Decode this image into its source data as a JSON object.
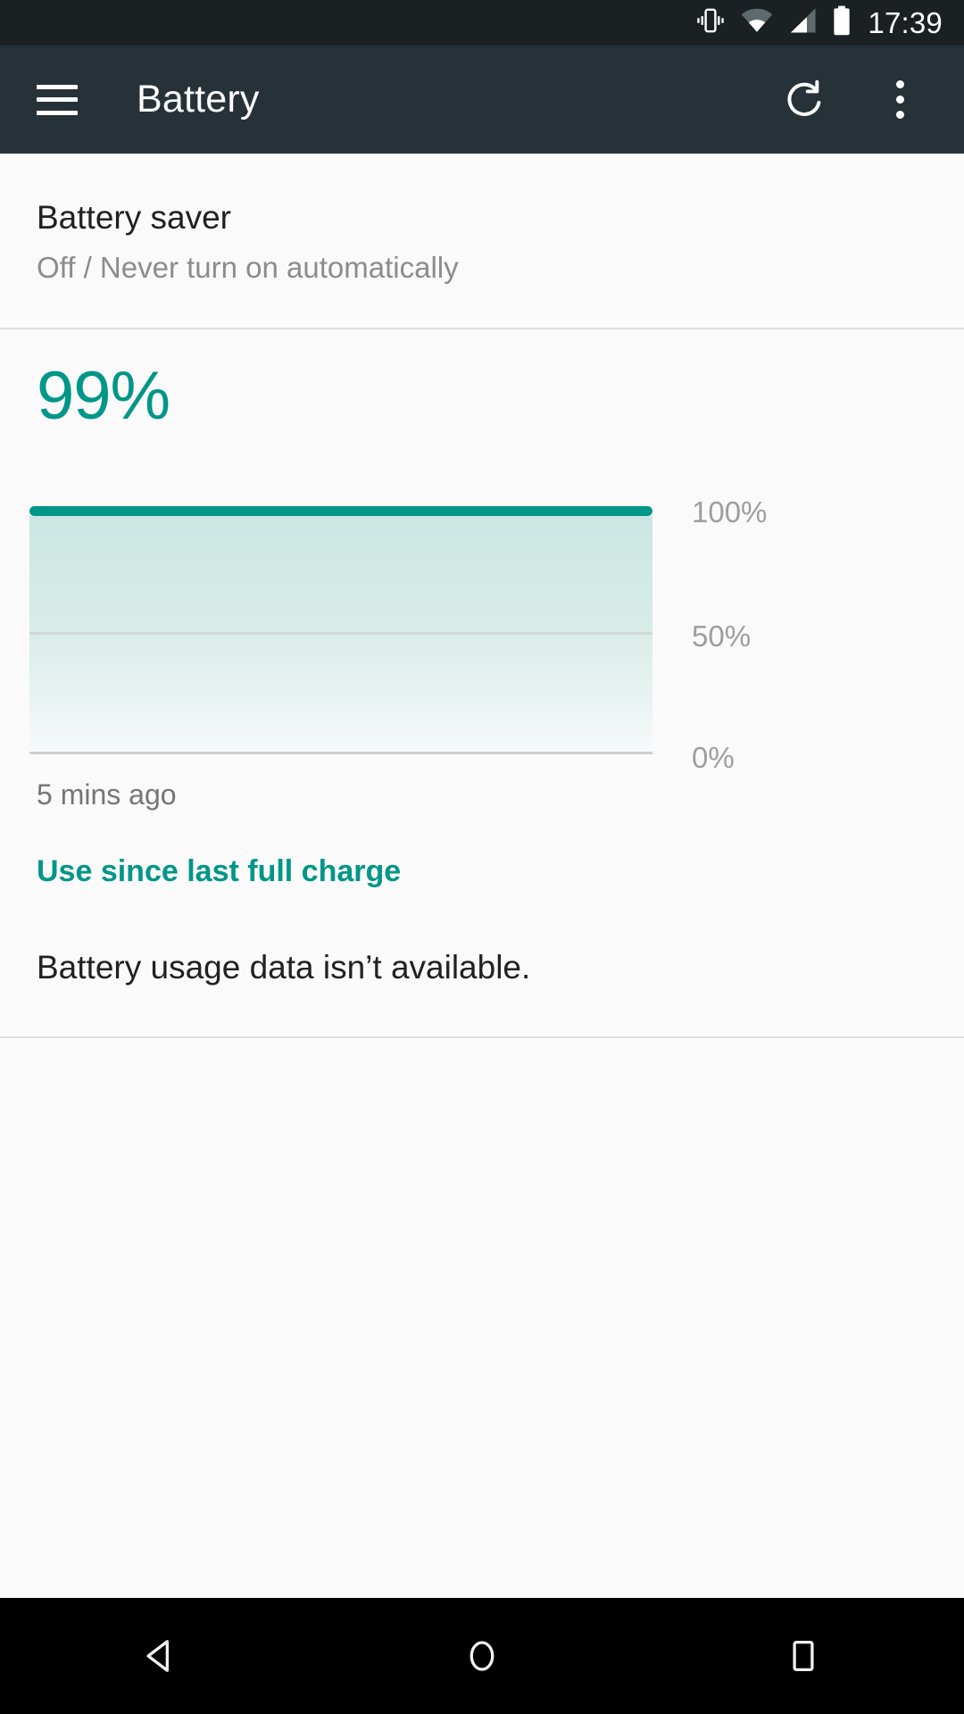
{
  "status_bar": {
    "time": "17:39",
    "icons": [
      "vibrate-icon",
      "wifi-icon",
      "cellular-signal-icon",
      "battery-icon"
    ],
    "background_color": "#1b2023"
  },
  "app_bar": {
    "menu_icon": "hamburger-menu-icon",
    "title": "Battery",
    "refresh_icon": "refresh-icon",
    "overflow_icon": "overflow-menu-icon",
    "background_color": "#263238"
  },
  "battery_saver": {
    "title": "Battery saver",
    "subtitle": "Off / Never turn on automatically"
  },
  "battery_level": {
    "percent_label": "99%",
    "accent_color": "#009688"
  },
  "chart_labels": {
    "y_100": "100%",
    "y_50": "50%",
    "y_0": "0%",
    "time_ago": "5 mins ago"
  },
  "links": {
    "use_since_last_full_charge": "Use since last full charge"
  },
  "usage": {
    "empty_message": "Battery usage data isn’t available."
  },
  "nav_bar": {
    "back": "back-icon",
    "home": "home-icon",
    "recents": "recents-icon",
    "background_color": "#000000"
  },
  "chart_data": {
    "type": "area",
    "title": "",
    "xlabel": "",
    "ylabel": "",
    "ylim": [
      0,
      100
    ],
    "yticks": [
      0,
      50,
      100
    ],
    "ytick_labels": [
      "0%",
      "50%",
      "100%"
    ],
    "grid": true,
    "legend": "none",
    "line_color": "#009688",
    "fill_color": "#cbe7e3",
    "series": [
      {
        "name": "Battery level",
        "x": [
          0,
          20,
          40,
          60,
          80,
          100
        ],
        "values": [
          100,
          100,
          100,
          100,
          100,
          100
        ]
      }
    ],
    "annotation": "5 mins ago"
  }
}
